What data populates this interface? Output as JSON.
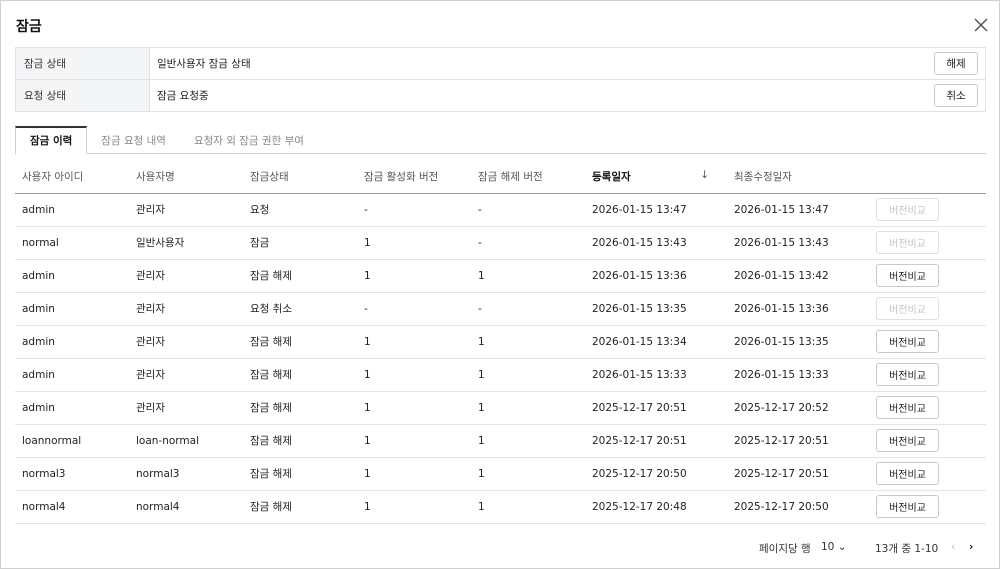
{
  "dialog": {
    "title": "잠금",
    "close_icon": "close-icon"
  },
  "info": {
    "lock_status": {
      "label": "잠금 상태",
      "value": "일반사용자 잠금 상태",
      "button": "해제"
    },
    "request_status": {
      "label": "요청 상태",
      "value": "잠금 요청중",
      "button": "취소"
    }
  },
  "tabs": [
    {
      "label": "잠금 이력",
      "active": true
    },
    {
      "label": "잠금 요청 내역",
      "active": false
    },
    {
      "label": "요청자 외 잠금 권한 부여",
      "active": false
    }
  ],
  "table": {
    "columns": [
      "사용자 아이디",
      "사용자명",
      "잠금상태",
      "잠금 활성화 버전",
      "잠금 해제 버전",
      "등록일자",
      "최종수정일자",
      ""
    ],
    "sort_indicator": "↓",
    "compare_label": "버전비교",
    "rows": [
      {
        "user_id": "admin",
        "user_name": "관리자",
        "status": "요청",
        "lock_ver": "-",
        "unlock_ver": "-",
        "registered": "2026-01-15 13:47",
        "modified": "2026-01-15 13:47",
        "compare_enabled": false
      },
      {
        "user_id": "normal",
        "user_name": "일반사용자",
        "status": "잠금",
        "lock_ver": "1",
        "unlock_ver": "-",
        "registered": "2026-01-15 13:43",
        "modified": "2026-01-15 13:43",
        "compare_enabled": false
      },
      {
        "user_id": "admin",
        "user_name": "관리자",
        "status": "잠금 해제",
        "lock_ver": "1",
        "unlock_ver": "1",
        "registered": "2026-01-15 13:36",
        "modified": "2026-01-15 13:42",
        "compare_enabled": true
      },
      {
        "user_id": "admin",
        "user_name": "관리자",
        "status": "요청 취소",
        "lock_ver": "-",
        "unlock_ver": "-",
        "registered": "2026-01-15 13:35",
        "modified": "2026-01-15 13:36",
        "compare_enabled": false
      },
      {
        "user_id": "admin",
        "user_name": "관리자",
        "status": "잠금 해제",
        "lock_ver": "1",
        "unlock_ver": "1",
        "registered": "2026-01-15 13:34",
        "modified": "2026-01-15 13:35",
        "compare_enabled": true
      },
      {
        "user_id": "admin",
        "user_name": "관리자",
        "status": "잠금 해제",
        "lock_ver": "1",
        "unlock_ver": "1",
        "registered": "2026-01-15 13:33",
        "modified": "2026-01-15 13:33",
        "compare_enabled": true
      },
      {
        "user_id": "admin",
        "user_name": "관리자",
        "status": "잠금 해제",
        "lock_ver": "1",
        "unlock_ver": "1",
        "registered": "2025-12-17 20:51",
        "modified": "2025-12-17 20:52",
        "compare_enabled": true
      },
      {
        "user_id": "loannormal",
        "user_name": "loan-normal",
        "status": "잠금 해제",
        "lock_ver": "1",
        "unlock_ver": "1",
        "registered": "2025-12-17 20:51",
        "modified": "2025-12-17 20:51",
        "compare_enabled": true
      },
      {
        "user_id": "normal3",
        "user_name": "normal3",
        "status": "잠금 해제",
        "lock_ver": "1",
        "unlock_ver": "1",
        "registered": "2025-12-17 20:50",
        "modified": "2025-12-17 20:51",
        "compare_enabled": true
      },
      {
        "user_id": "normal4",
        "user_name": "normal4",
        "status": "잠금 해제",
        "lock_ver": "1",
        "unlock_ver": "1",
        "registered": "2025-12-17 20:48",
        "modified": "2025-12-17 20:50",
        "compare_enabled": true
      }
    ]
  },
  "pagination": {
    "rows_per_page_label": "페이지당 행",
    "rows_per_page": "10",
    "range": "13개 중 1-10",
    "prev_icon": "chevron-left-icon",
    "next_icon": "chevron-right-icon"
  }
}
